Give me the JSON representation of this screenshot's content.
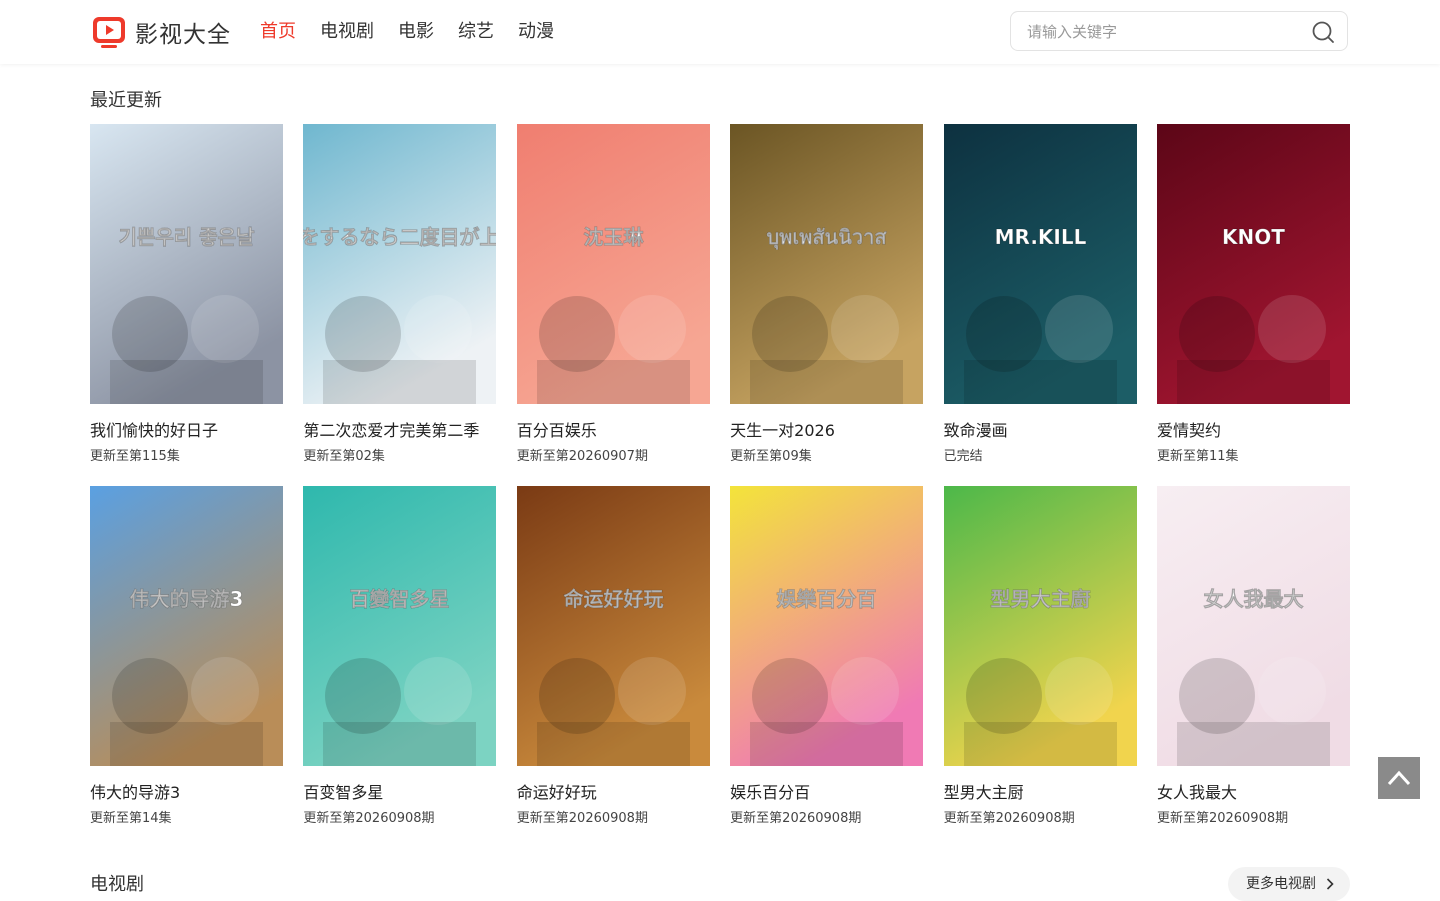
{
  "header": {
    "logo_text": "影视大全",
    "nav": [
      {
        "label": "首页",
        "active": true
      },
      {
        "label": "电视剧",
        "active": false
      },
      {
        "label": "电影",
        "active": false
      },
      {
        "label": "综艺",
        "active": false
      },
      {
        "label": "动漫",
        "active": false
      }
    ],
    "search_placeholder": "请输入关键字",
    "search_icon": "search-icon"
  },
  "recent": {
    "title": "最近更新",
    "items": [
      {
        "title": "我们愉快的好日子",
        "status": "更新至第115集",
        "colors": [
          "#d8e6f1",
          "#8c93a3"
        ],
        "poster_text": "기쁜우리 좋은날"
      },
      {
        "title": "第二次恋爱才完美第二季",
        "status": "更新至第02集",
        "colors": [
          "#6fb7cf",
          "#eef2f5"
        ],
        "poster_text": "恋をするなら二度目が上等"
      },
      {
        "title": "百分百娱乐",
        "status": "更新至第20260907期",
        "colors": [
          "#f07e70",
          "#f6a693"
        ],
        "poster_text": "沈玉琳"
      },
      {
        "title": "天生一对2026",
        "status": "更新至第09集",
        "colors": [
          "#6b5524",
          "#c6a361"
        ],
        "poster_text": "บุพเพสันนิวาส"
      },
      {
        "title": "致命漫画",
        "status": "已完结",
        "colors": [
          "#0d3140",
          "#1c5d66"
        ],
        "poster_text": "MR.KILL"
      },
      {
        "title": "爱情契约",
        "status": "更新至第11集",
        "colors": [
          "#5c0617",
          "#a01530"
        ],
        "poster_text": "KNOT"
      },
      {
        "title": "伟大的导游3",
        "status": "更新至第14集",
        "colors": [
          "#5aa0e2",
          "#b98d58"
        ],
        "poster_text": "伟大的导游3"
      },
      {
        "title": "百变智多星",
        "status": "更新至第20260908期",
        "colors": [
          "#2eb8ad",
          "#7cd3c2"
        ],
        "poster_text": "百變智多星"
      },
      {
        "title": "命运好好玩",
        "status": "更新至第20260908期",
        "colors": [
          "#7a3a14",
          "#c98a3c"
        ],
        "poster_text": "命运好好玩"
      },
      {
        "title": "娱乐百分百",
        "status": "更新至第20260908期",
        "colors": [
          "#f3e43a",
          "#f07ab4"
        ],
        "poster_text": "娛樂百分百"
      },
      {
        "title": "型男大主厨",
        "status": "更新至第20260908期",
        "colors": [
          "#4cb84a",
          "#f1d44d"
        ],
        "poster_text": "型男大主廚"
      },
      {
        "title": "女人我最大",
        "status": "更新至第20260908期",
        "colors": [
          "#f7eef2",
          "#f0dce5"
        ],
        "poster_text": "女人我最大"
      }
    ]
  },
  "tv": {
    "title": "电视剧",
    "more_label": "更多电视剧"
  },
  "back_to_top_icon": "arrow-up-icon"
}
